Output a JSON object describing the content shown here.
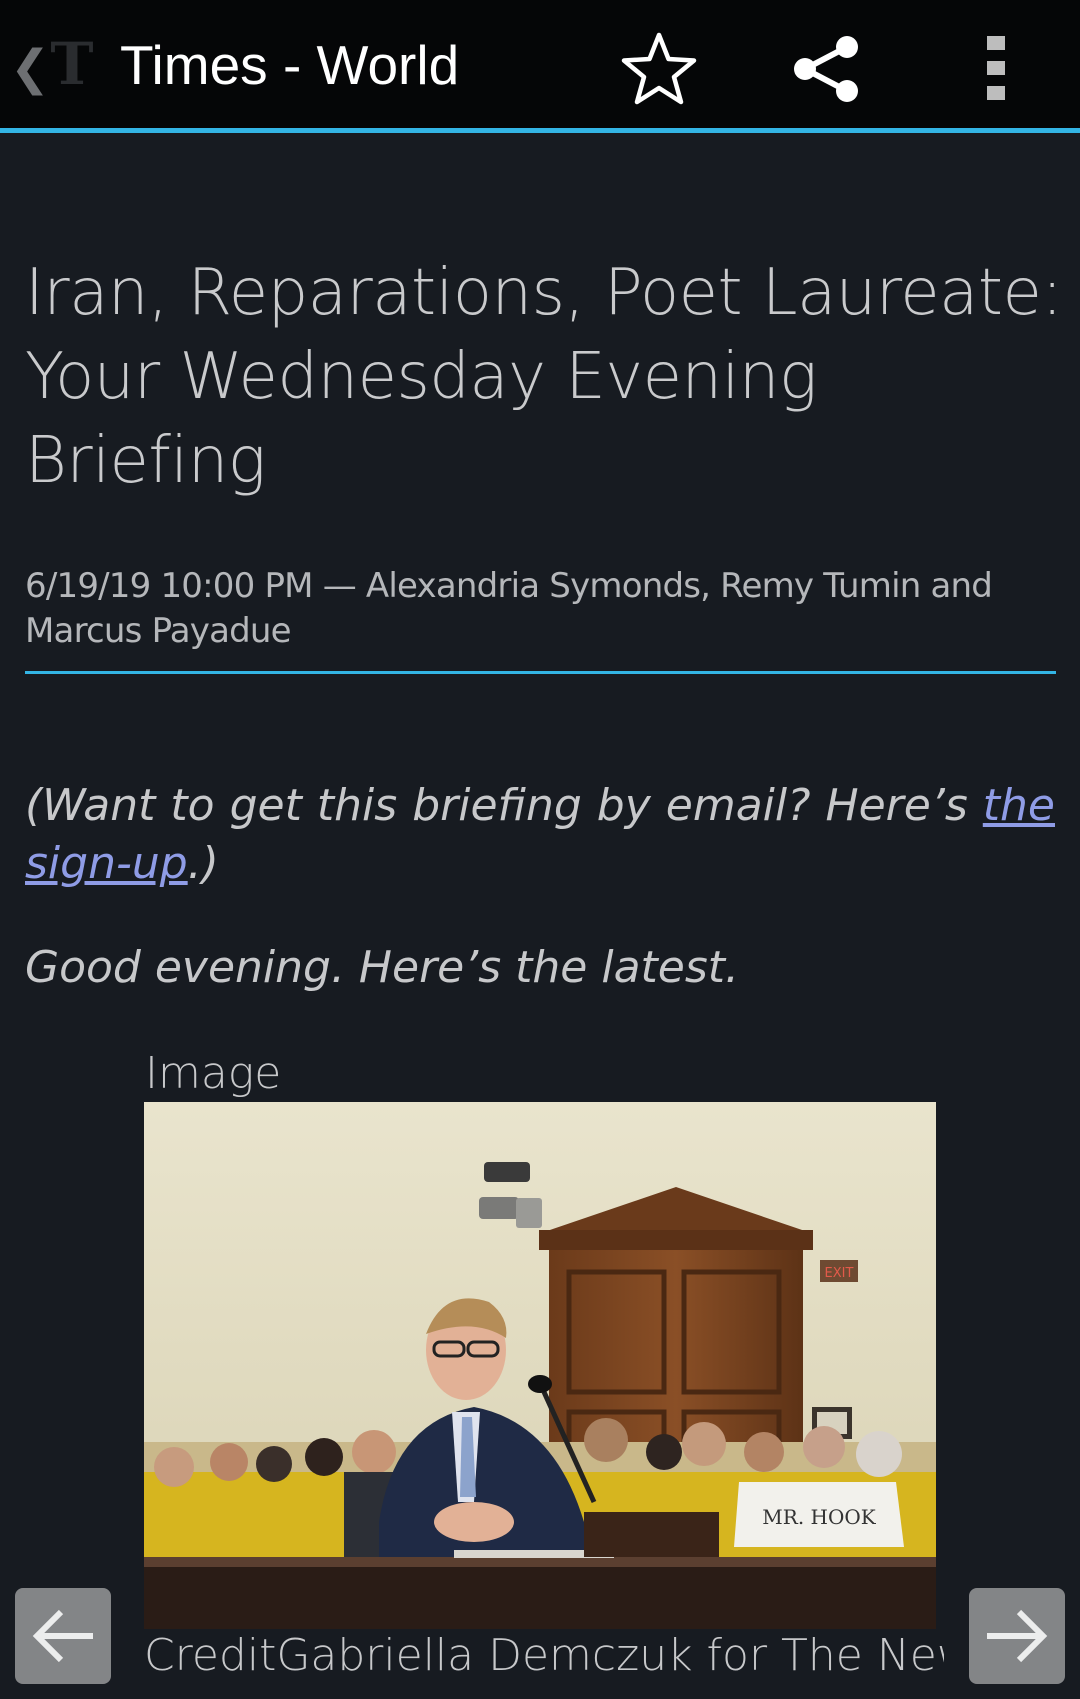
{
  "appbar": {
    "title": "Times - World",
    "back_glyph": "❮",
    "logo_glyph": "T",
    "icons": {
      "back": "chevron-left-icon",
      "logo": "nyt-logo",
      "star": "star-icon",
      "share": "share-icon",
      "overflow": "more-vert-icon"
    },
    "accent_color": "#33b5e5"
  },
  "article": {
    "headline": "Iran, Reparations, Poet Laureate: Your Wednesday Evening Briefing",
    "byline": "6/19/19 10:00 PM — Alexandria Symonds, Remy Tumin and Marcus Payadue",
    "email_prefix": "(Want to get this briefing by email? Here’s ",
    "email_link": "the sign-up",
    "email_suffix": ".)",
    "greeting": "Good evening. Here’s the latest.",
    "figure_label": "Image",
    "figure_sign": "MR. HOOK",
    "figure_exit_sign": "EXIT",
    "credit": "CreditGabriella Demczuk for The New York Times",
    "link_color": "#8f9ce6"
  },
  "navigation": {
    "prev_icon": "arrow-left-icon",
    "next_icon": "arrow-right-icon"
  }
}
